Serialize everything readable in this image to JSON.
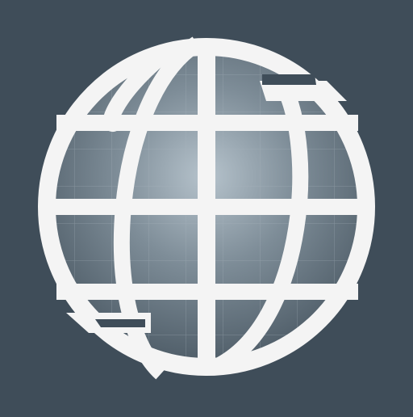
{
  "icon": {
    "name": "globe-icon",
    "colors": {
      "background": "#3f4d59",
      "globe_outline": "#f4f4f4",
      "globe_fill_center": "#b5c2cb",
      "globe_fill_edge": "#4b5964",
      "fine_grid": "#9eaab4"
    }
  }
}
